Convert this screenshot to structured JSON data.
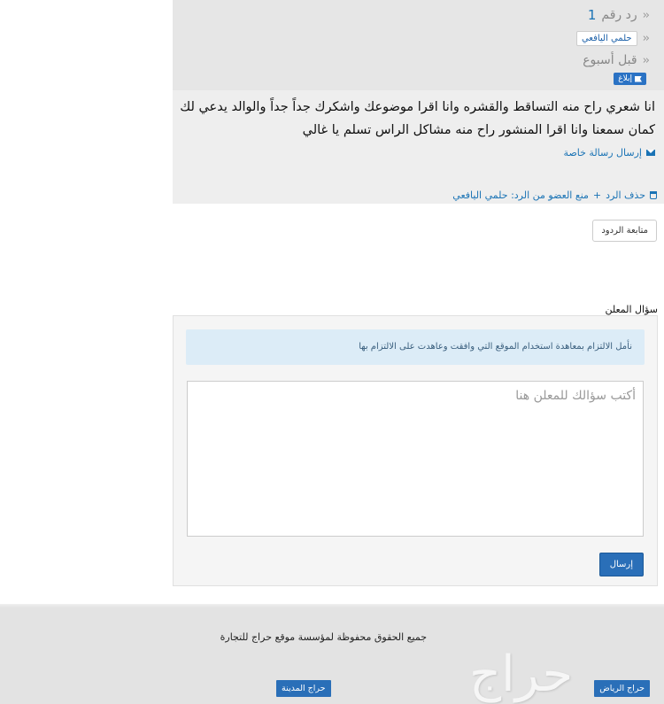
{
  "reply": {
    "reply_number_label": "رد رقم",
    "reply_number": "1",
    "author": "حلمي اليافعي",
    "time": "قبل أسبوع",
    "report_label": "إبلاغ",
    "comment": "انا شعري راح منه التساقط والقشره وانا اقرا موضوعك واشكرك جداً جداً والوالد يدعي لك كمان سمعنا وانا اقرا المنشور راح منه مشاكل الراس تسلم يا غالي",
    "private_message_label": "إرسال رسالة خاصة",
    "delete_label": "حذف الرد",
    "plus": "+",
    "ban_label": "منع العضو من الرد: حلمي اليافعي"
  },
  "follow_replies_label": "متابعة الردود",
  "question": {
    "label": "سؤال المعلن",
    "notice": "نأمل الالتزام بمعاهدة استخدام الموقع التي وافقت وعاهدت على الالتزام بها",
    "placeholder": "أكتب سؤالك للمعلن هنا",
    "value": "",
    "send_label": "إرسال"
  },
  "footer": {
    "copyright": "جميع الحقوق محفوظة لمؤسسة موقع حراج للتجارة",
    "logo_text": "حراج",
    "city_buttons": [
      "حراج الرياض",
      "حراج المدينة"
    ]
  },
  "colors": {
    "accent": "#2a6fb8",
    "link": "#1a73b5",
    "notice_bg": "#dcecf7",
    "footer_bg": "#e3e3e3"
  },
  "icons": [
    "chevrons-icon",
    "flag-icon",
    "envelope-icon",
    "trash-icon"
  ]
}
